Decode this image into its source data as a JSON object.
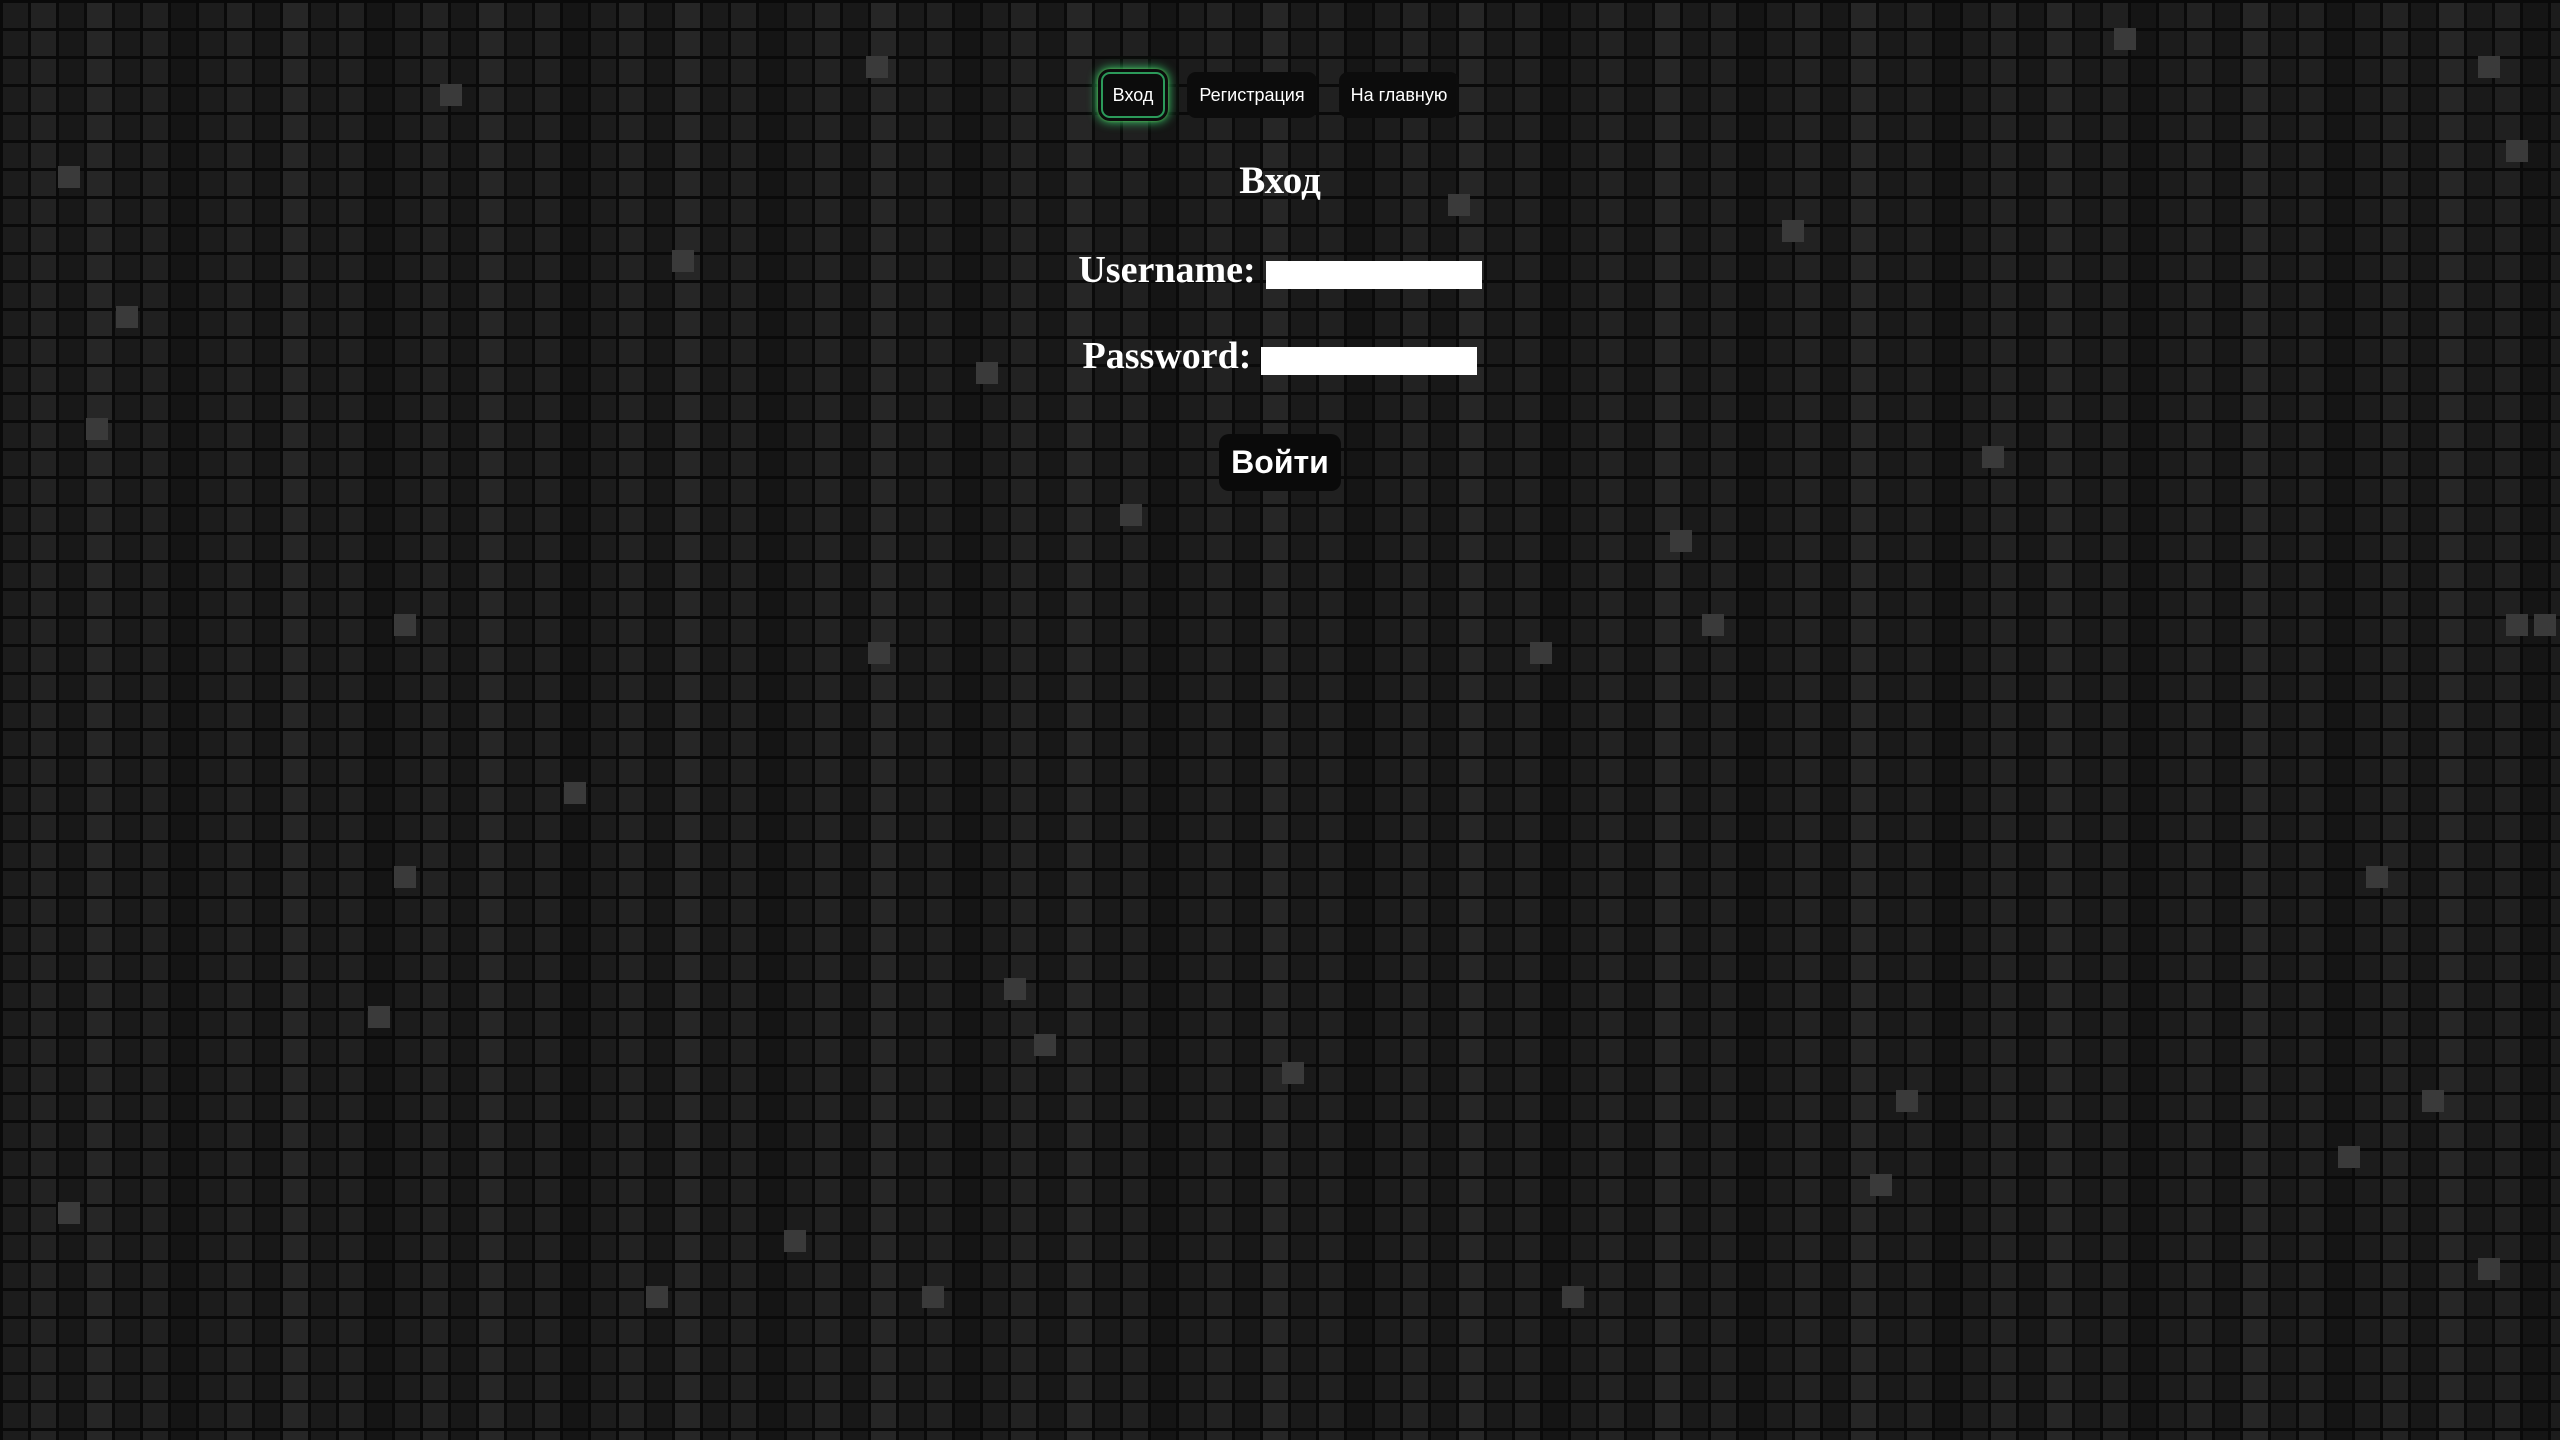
{
  "nav": {
    "items": [
      {
        "label": "Вход",
        "active": true
      },
      {
        "label": "Регистрация",
        "active": false
      },
      {
        "label": "На главную",
        "active": false
      }
    ]
  },
  "form": {
    "title": "Вход",
    "username_label": "Username:",
    "username_value": "",
    "password_label": "Password:",
    "password_value": "",
    "submit_label": "Войти"
  },
  "colors": {
    "background": "#101010",
    "text": "#ffffff",
    "active_glow": "#3ce678"
  }
}
